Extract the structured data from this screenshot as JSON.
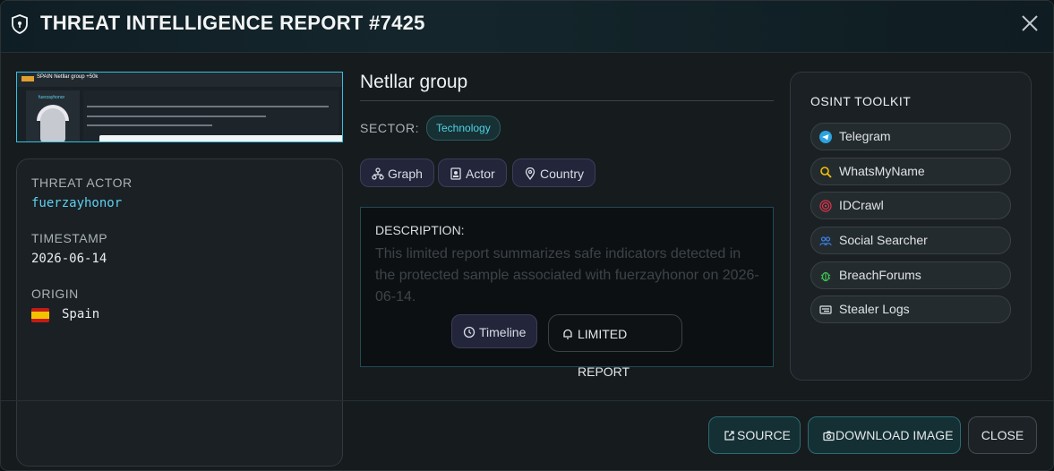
{
  "header": {
    "title": "THREAT INTELLIGENCE REPORT #7425"
  },
  "thumbnail": {
    "headline": "SPAIN Netllar group +50k",
    "actor": "fuerzayhonor"
  },
  "details": {
    "actor_label": "THREAT ACTOR",
    "actor_value": "fuerzayhonor",
    "timestamp_label": "TIMESTAMP",
    "timestamp_value": "2026-06-14",
    "origin_label": "ORIGIN",
    "origin_value": "Spain"
  },
  "report": {
    "name": "Netllar group",
    "sector_label": "SECTOR:",
    "sector_value": "Technology",
    "pills": {
      "graph": "Graph",
      "actor": "Actor",
      "country": "Country"
    },
    "description_label": "DESCRIPTION:",
    "description_text": "This limited report summarizes safe indicators detected in the protected sample associated with fuerzayhonor on 2026-06-14.",
    "timeline_button": "Timeline",
    "limited_button": "LIMITED REPORT"
  },
  "osint": {
    "title": "OSINT TOOLKIT",
    "tools": [
      "Telegram",
      "WhatsMyName",
      "IDCrawl",
      "Social Searcher",
      "BreachForums",
      "Stealer Logs"
    ]
  },
  "footer": {
    "source": "SOURCE",
    "download": "DOWNLOAD IMAGE",
    "close": "CLOSE"
  },
  "colors": {
    "accent": "#4fd2e6",
    "actor": "#5fd0f0",
    "background": "#161b1e"
  }
}
